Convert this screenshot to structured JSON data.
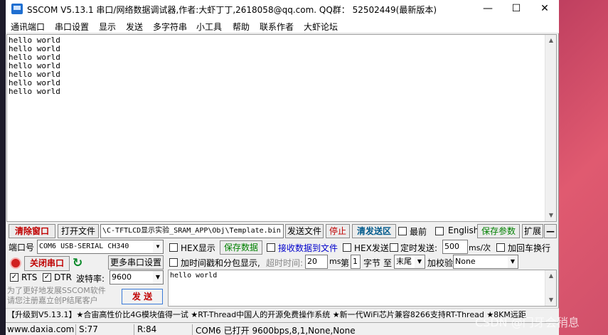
{
  "window": {
    "title": "SSCOM V5.13.1 串口/网络数据调试器,作者:大虾丁丁,2618058@qq.com. QQ群： 52502449(最新版本)",
    "minimize": "—",
    "maximize": "☐",
    "close": "✕"
  },
  "menu": [
    "通讯端口",
    "串口设置",
    "显示",
    "发送",
    "多字符串",
    "小工具",
    "帮助",
    "联系作者",
    "大虾论坛"
  ],
  "receive": {
    "lines": [
      "hello world",
      "hello world",
      "hello world",
      "hello world",
      "hello world",
      "hello world",
      "hello world"
    ]
  },
  "toolbar1": {
    "clear_window": "清除窗口",
    "open_file": "打开文件",
    "file_path": "\\C-TFTLCD显示实验_SRAM_APP\\Obj\\Template.bin",
    "send_file": "发送文件",
    "stop": "停止",
    "clear_send": "清发送区",
    "latest_label": "最前",
    "english_label": "English",
    "save_params": "保存参数",
    "expand": "扩展",
    "collapse": "—"
  },
  "port": {
    "port_label": "端口号",
    "port_value": "COM6 USB-SERIAL CH340",
    "close_port": "关闭串口",
    "more_settings": "更多串口设置",
    "rts": "RTS",
    "dtr": "DTR",
    "baud_label": "波特率:",
    "baud_value": "9600",
    "promo": "为了更好地发展SSCOM软件\n请您注册嘉立创P结尾客户",
    "send_button": "发 送"
  },
  "options": {
    "hex_display": "HEX显示",
    "save_data": "保存数据",
    "recv_to_file": "接收数据到文件",
    "hex_send": "HEX发送",
    "timed_send": "定时发送:",
    "timed_value": "500",
    "timed_unit": "ms/次",
    "add_crlf": "加回车换行",
    "add_timestamp": "加时间戳和分包显示,",
    "timeout_label": "超时时间:",
    "timeout_value": "20",
    "timeout_unit": "ms",
    "nth_label": "第",
    "nth_value": "1",
    "byte_label": "字节",
    "to_label": "至",
    "to_value": "末尾",
    "checksum_label": "加校验",
    "checksum_value": "None"
  },
  "send": {
    "text": "hello world"
  },
  "marquee": "【升级到V5.13.1】★合宙高性价比4G模块值得一试 ★RT-Thread中国人的开源免费操作系统 ★新一代WiFi芯片兼容8266支持RT-Thread ★8KM远距",
  "status": {
    "website": "www.daxia.com",
    "sent": "S:77",
    "received": "R:84",
    "port_state": "COM6 已打开  9600bps,8,1,None,None"
  },
  "watermark": "CSDN @门牙会稍息"
}
